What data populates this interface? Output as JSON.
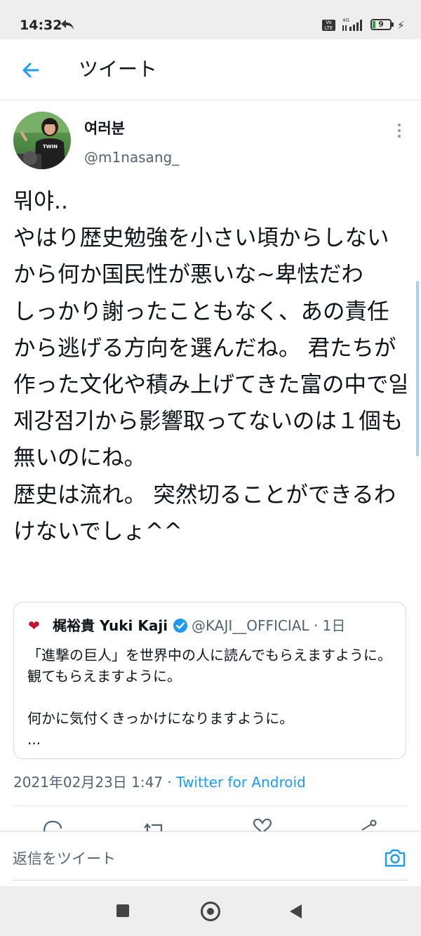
{
  "status_bar": {
    "time": "14:32",
    "volte": "Vo LTE",
    "network": "4G",
    "battery": "9"
  },
  "header": {
    "title": "ツイート"
  },
  "tweet": {
    "display_name": "여러분",
    "handle": "@m1nasang_",
    "avatar_shirt_text": "TWIN",
    "text": "뭐야..\nやはり歴史勉強を小さい頃からしないから何か国民性が悪いな~卑怯だわ\nしっかり謝ったこともなく、あの責任から逃げる方向を選んだね。 君たちが作った文化や積み上げてきた富の中で일제강점기から影響取ってないのは１個も無いのにね。\n歴史は流れ。 突然切ることができるわけないでしょ^^",
    "date": "2021年02月23日 1:47",
    "separator": " · ",
    "source": "Twitter for Android"
  },
  "quoted_tweet": {
    "display_name": "梶裕貴 Yuki Kaji",
    "handle": "@KAJI__OFFICIAL",
    "time": "· 1日",
    "text": "「進撃の巨人」を世界中の人に読んでもらえますように。観てもらえますように。\n\n何かに気付くきっかけになりますように。\n..."
  },
  "reply_bar": {
    "placeholder": "返信をツイート"
  },
  "colors": {
    "accent": "#1d9bf0",
    "secondary_text": "#536471",
    "primary_text": "#0f1419"
  },
  "icons": [
    "back-arrow-icon",
    "more-icon",
    "heart-avatar-icon",
    "verified-icon",
    "reply-icon",
    "retweet-icon",
    "like-icon",
    "share-icon",
    "camera-icon"
  ]
}
